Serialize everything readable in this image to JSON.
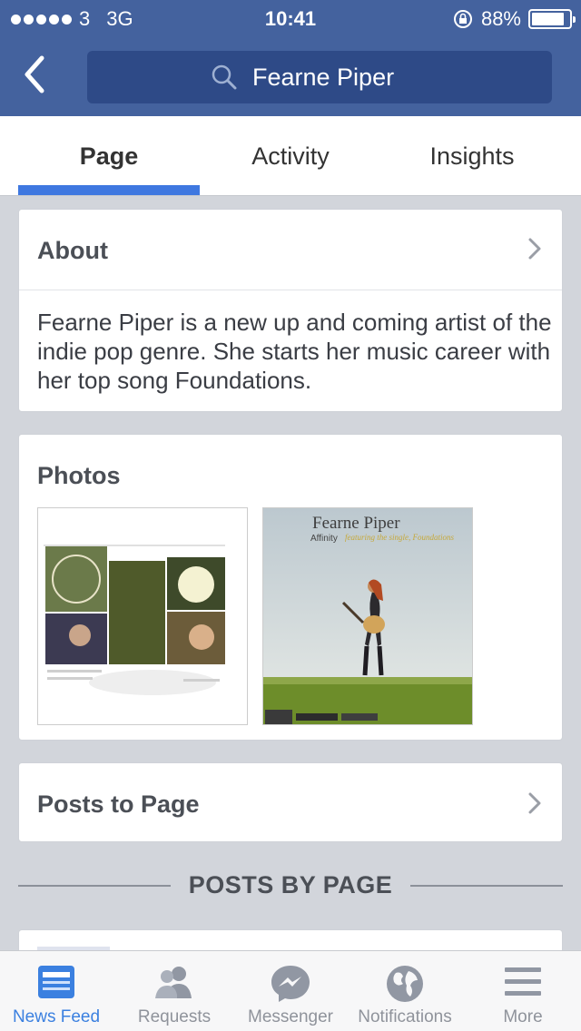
{
  "status": {
    "carrier": "3",
    "network": "3G",
    "time": "10:41",
    "battery_percent_label": "88%",
    "battery_level": 0.88
  },
  "header": {
    "search_text": "Fearne Piper"
  },
  "tabs": [
    {
      "label": "Page",
      "active": true
    },
    {
      "label": "Activity",
      "active": false
    },
    {
      "label": "Insights",
      "active": false
    }
  ],
  "about": {
    "title": "About",
    "description": "Fearne Piper is a new up and coming artist of the indie pop genre. She starts her music career with her top song Foundations."
  },
  "photos": {
    "title": "Photos",
    "album_art_title": "Fearne  Piper",
    "album_art_subtitle": "Affinity",
    "album_art_tagline": "featuring the single, Foundations"
  },
  "posts_to_page": {
    "title": "Posts to Page"
  },
  "posts_by_page": {
    "label": "POSTS BY PAGE"
  },
  "tabbar": [
    {
      "label": "News Feed",
      "icon": "news-feed-icon",
      "active": true
    },
    {
      "label": "Requests",
      "icon": "friend-requests-icon",
      "active": false
    },
    {
      "label": "Messenger",
      "icon": "messenger-icon",
      "active": false
    },
    {
      "label": "Notifications",
      "icon": "globe-icon",
      "active": false
    },
    {
      "label": "More",
      "icon": "menu-icon",
      "active": false
    }
  ],
  "colors": {
    "brand_blue": "#44629e",
    "search_bg": "#2e4a87",
    "accent_blue": "#3b80e0"
  }
}
